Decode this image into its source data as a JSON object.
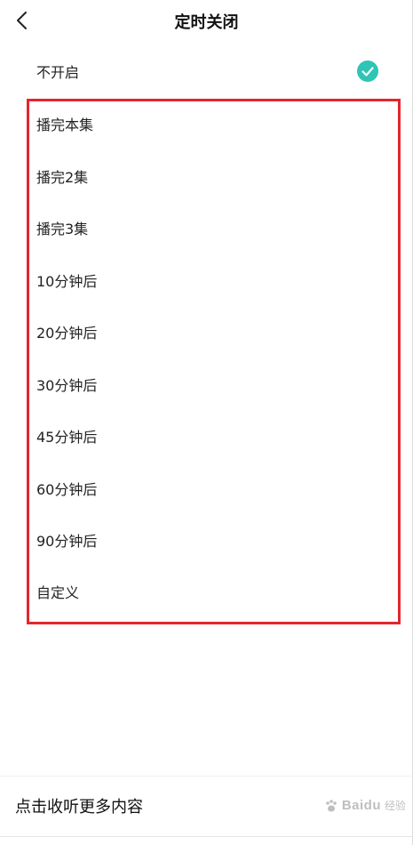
{
  "header": {
    "title": "定时关闭",
    "back_icon": "chevron-left-icon"
  },
  "options": [
    {
      "label": "不开启",
      "selected": true
    },
    {
      "label": "播完本集",
      "selected": false
    },
    {
      "label": "播完2集",
      "selected": false
    },
    {
      "label": "播完3集",
      "selected": false
    },
    {
      "label": "10分钟后",
      "selected": false
    },
    {
      "label": "20分钟后",
      "selected": false
    },
    {
      "label": "30分钟后",
      "selected": false
    },
    {
      "label": "45分钟后",
      "selected": false
    },
    {
      "label": "60分钟后",
      "selected": false
    },
    {
      "label": "90分钟后",
      "selected": false
    },
    {
      "label": "自定义",
      "selected": false
    }
  ],
  "footer": {
    "link_text": "点击收听更多内容"
  },
  "watermark": {
    "text": "Baidu",
    "subtext": "经验"
  },
  "colors": {
    "check_accent": "#2ec4b6",
    "highlight_border": "#e5252d"
  }
}
